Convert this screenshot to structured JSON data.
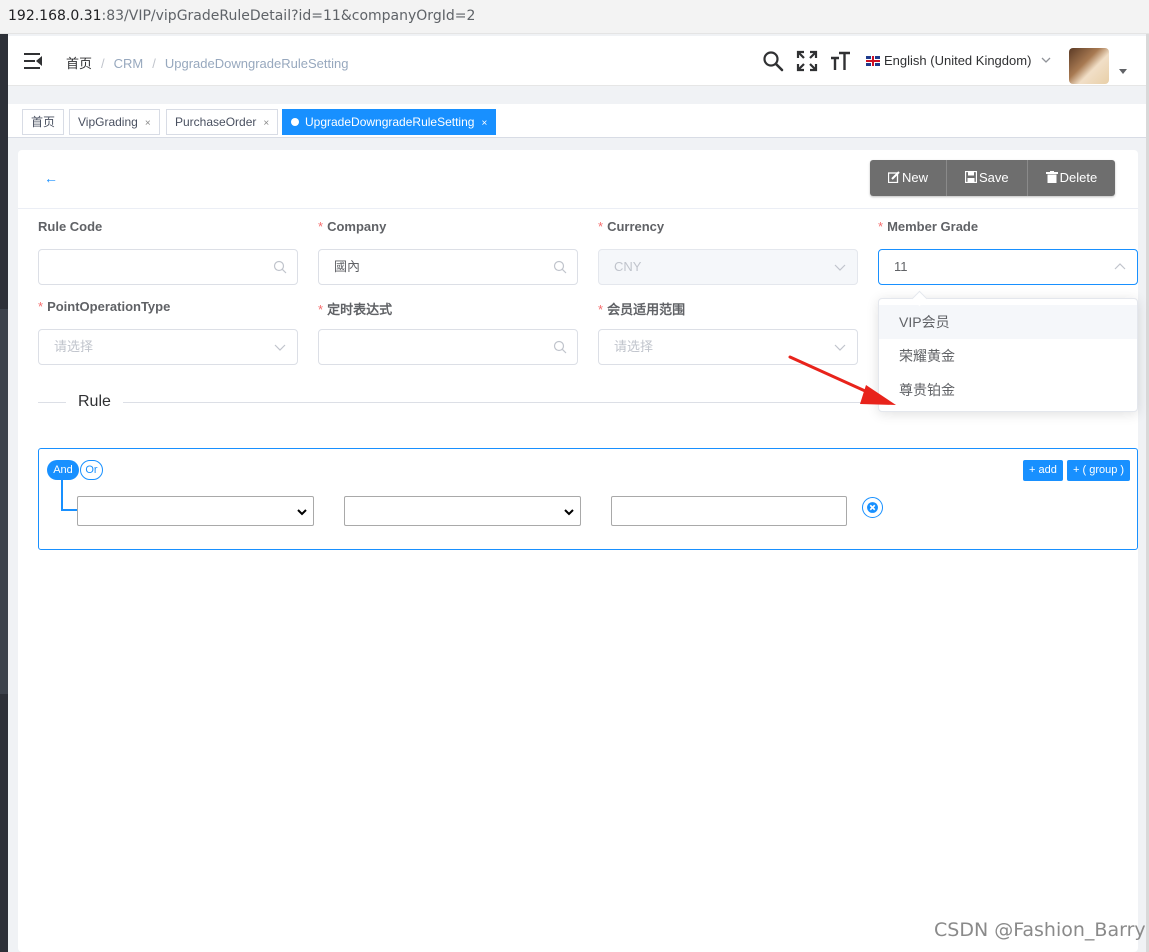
{
  "browser": {
    "url_host": "192.168.0.31",
    "url_rest": ":83/VIP/vipGradeRuleDetail?id=11&companyOrgId=2"
  },
  "header": {
    "breadcrumb": [
      "首页",
      "CRM",
      "UpgradeDowngradeRuleSetting"
    ],
    "breadcrumb_sep": "/",
    "language": "English (United Kingdom)",
    "icons": [
      "menu-fold-icon",
      "search-icon",
      "fullscreen-icon",
      "font-size-icon",
      "uk-flag-icon",
      "chevron-down-icon"
    ]
  },
  "tags": [
    {
      "label": "首页",
      "closable": false,
      "active": false
    },
    {
      "label": "VipGrading",
      "closable": true,
      "active": false
    },
    {
      "label": "PurchaseOrder",
      "closable": true,
      "active": false
    },
    {
      "label": "UpgradeDowngradeRuleSetting",
      "closable": true,
      "active": true
    }
  ],
  "tag_close": "×",
  "toolbar": {
    "back": "←",
    "new": "New",
    "save": "Save",
    "delete": "Delete"
  },
  "form": {
    "rule_code": {
      "label": "Rule Code",
      "value": ""
    },
    "company": {
      "label": "Company",
      "value": "國內"
    },
    "currency": {
      "label": "Currency",
      "value": "CNY"
    },
    "member_grade": {
      "label": "Member Grade",
      "value": "11"
    },
    "point_operation_type": {
      "label": "PointOperationType",
      "placeholder": "请选择"
    },
    "cron": {
      "label": "定时表达式",
      "value": ""
    },
    "member_scope": {
      "label": "会员适用范围",
      "placeholder": "请选择"
    },
    "required_mark": "*"
  },
  "member_grade_options": [
    "VIP会员",
    "荣耀黄金",
    "尊贵铂金"
  ],
  "divider": {
    "title": "Rule"
  },
  "query_builder": {
    "and": "And",
    "or": "Or",
    "add": "+ add",
    "add_group": "+ ( group )"
  },
  "watermark": "CSDN @Fashion_Barry",
  "colors": {
    "primary": "#1890ff",
    "required": "#f56c6c",
    "button_gray": "#6e6e6e",
    "arrow": "#e8231b"
  }
}
